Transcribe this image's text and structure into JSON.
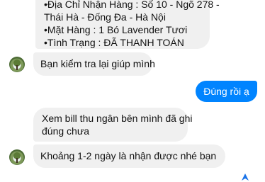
{
  "messages": [
    {
      "direction": "incoming",
      "lines": [
        "•Địa Chỉ Nhận Hàng : Số 10 - Ngõ 278 -",
        "Thái Hà - Đống Đa - Hà Nội",
        "•Mặt Hàng : 1 Bó Lavender Tươi",
        "•Tình Trạng : ĐÃ THANH TOÁN"
      ]
    },
    {
      "direction": "incoming",
      "lines": [
        "Bạn kiểm tra lại giúp mình"
      ]
    },
    {
      "direction": "outgoing",
      "lines": [
        "Đúng rồi ạ"
      ]
    },
    {
      "direction": "incoming",
      "lines": [
        "Xem bill thu ngân bên mình đã ghi",
        "đúng chưa"
      ]
    },
    {
      "direction": "incoming",
      "lines": [
        "Khoảng 1-2 ngày là nhận được nhé bạn"
      ]
    }
  ],
  "colors": {
    "incoming_bg": "#f0f0f0",
    "outgoing_bg": "#0084ff",
    "outgoing_text": "#ffffff"
  },
  "icons": {
    "avatar": "page-avatar",
    "seen_indicator": "seen-arrow-icon"
  }
}
